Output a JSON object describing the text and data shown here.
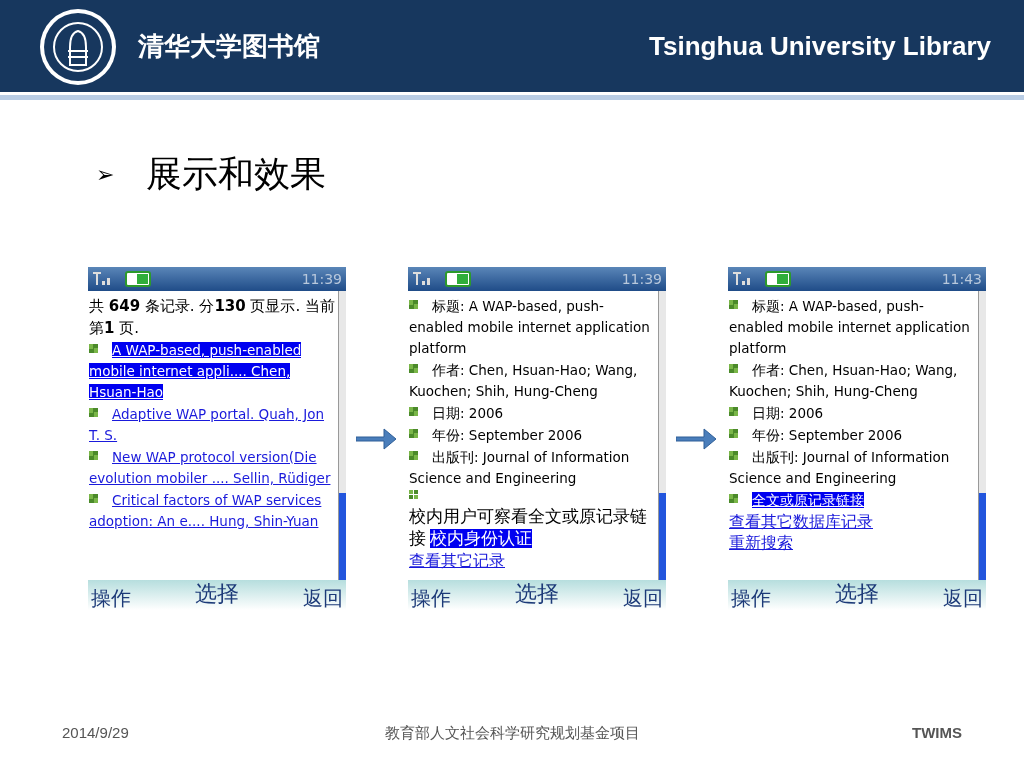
{
  "header": {
    "title_cn": "清华大学图书馆",
    "title_en": "Tsinghua University Library"
  },
  "heading": {
    "bullet": "➢",
    "text": "展示和效果"
  },
  "phones": [
    {
      "time": "11:39",
      "blocks": [
        {
          "kind": "summary",
          "text": "共 **649** 条记录. 分**130** 页显示. 当前第**1** 页."
        },
        {
          "kind": "result",
          "text": "A WAP-based, push-enabled mobile internet appli....  Chen, Hsuan-Hao",
          "selected": true
        },
        {
          "kind": "result",
          "text": "Adaptive WAP portal.  Quah, Jon T. S.",
          "selected": false
        },
        {
          "kind": "result",
          "text": "New WAP protocol version(Die evolution mobiler ....  Sellin, Rüdiger",
          "selected": false
        },
        {
          "kind": "result",
          "text": "Critical factors of WAP services adoption: An e....  Hung, Shin-Yuan",
          "selected": false
        }
      ],
      "softkeys": [
        "操作",
        "选择",
        "返回"
      ]
    },
    {
      "time": "11:39",
      "blocks": [
        {
          "kind": "field",
          "text": "标题: A WAP-based, push-enabled mobile internet application platform"
        },
        {
          "kind": "field",
          "text": "作者: Chen, Hsuan-Hao; Wang, Kuochen; Shih, Hung-Cheng"
        },
        {
          "kind": "field",
          "text": "日期: 2006"
        },
        {
          "kind": "field",
          "text": "年份: September 2006"
        },
        {
          "kind": "field",
          "text": "出版刊: Journal of Information Science and Engineering"
        },
        {
          "kind": "note",
          "text": "校内用户可察看全文或原记录链接",
          "link": "校内身份认证",
          "selected": true
        },
        {
          "kind": "link",
          "text": "查看其它记录"
        }
      ],
      "softkeys": [
        "操作",
        "选择",
        "返回"
      ]
    },
    {
      "time": "11:43",
      "blocks": [
        {
          "kind": "field",
          "text": "标题: A WAP-based, push-enabled mobile internet application platform"
        },
        {
          "kind": "field",
          "text": "作者: Chen, Hsuan-Hao; Wang, Kuochen; Shih, Hung-Cheng"
        },
        {
          "kind": "field",
          "text": "日期: 2006"
        },
        {
          "kind": "field",
          "text": "年份: September 2006"
        },
        {
          "kind": "field",
          "text": "出版刊: Journal of Information Science and Engineering"
        },
        {
          "kind": "result",
          "text": "全文或原记录链接",
          "selected": true
        },
        {
          "kind": "link",
          "text": "查看其它数据库记录"
        },
        {
          "kind": "link",
          "text": "重新搜索"
        }
      ],
      "softkeys": [
        "操作",
        "选择",
        "返回"
      ]
    }
  ],
  "footer": {
    "date": "2014/9/29",
    "center": "教育部人文社会科学研究规划基金项目",
    "right": "TWIMS"
  }
}
